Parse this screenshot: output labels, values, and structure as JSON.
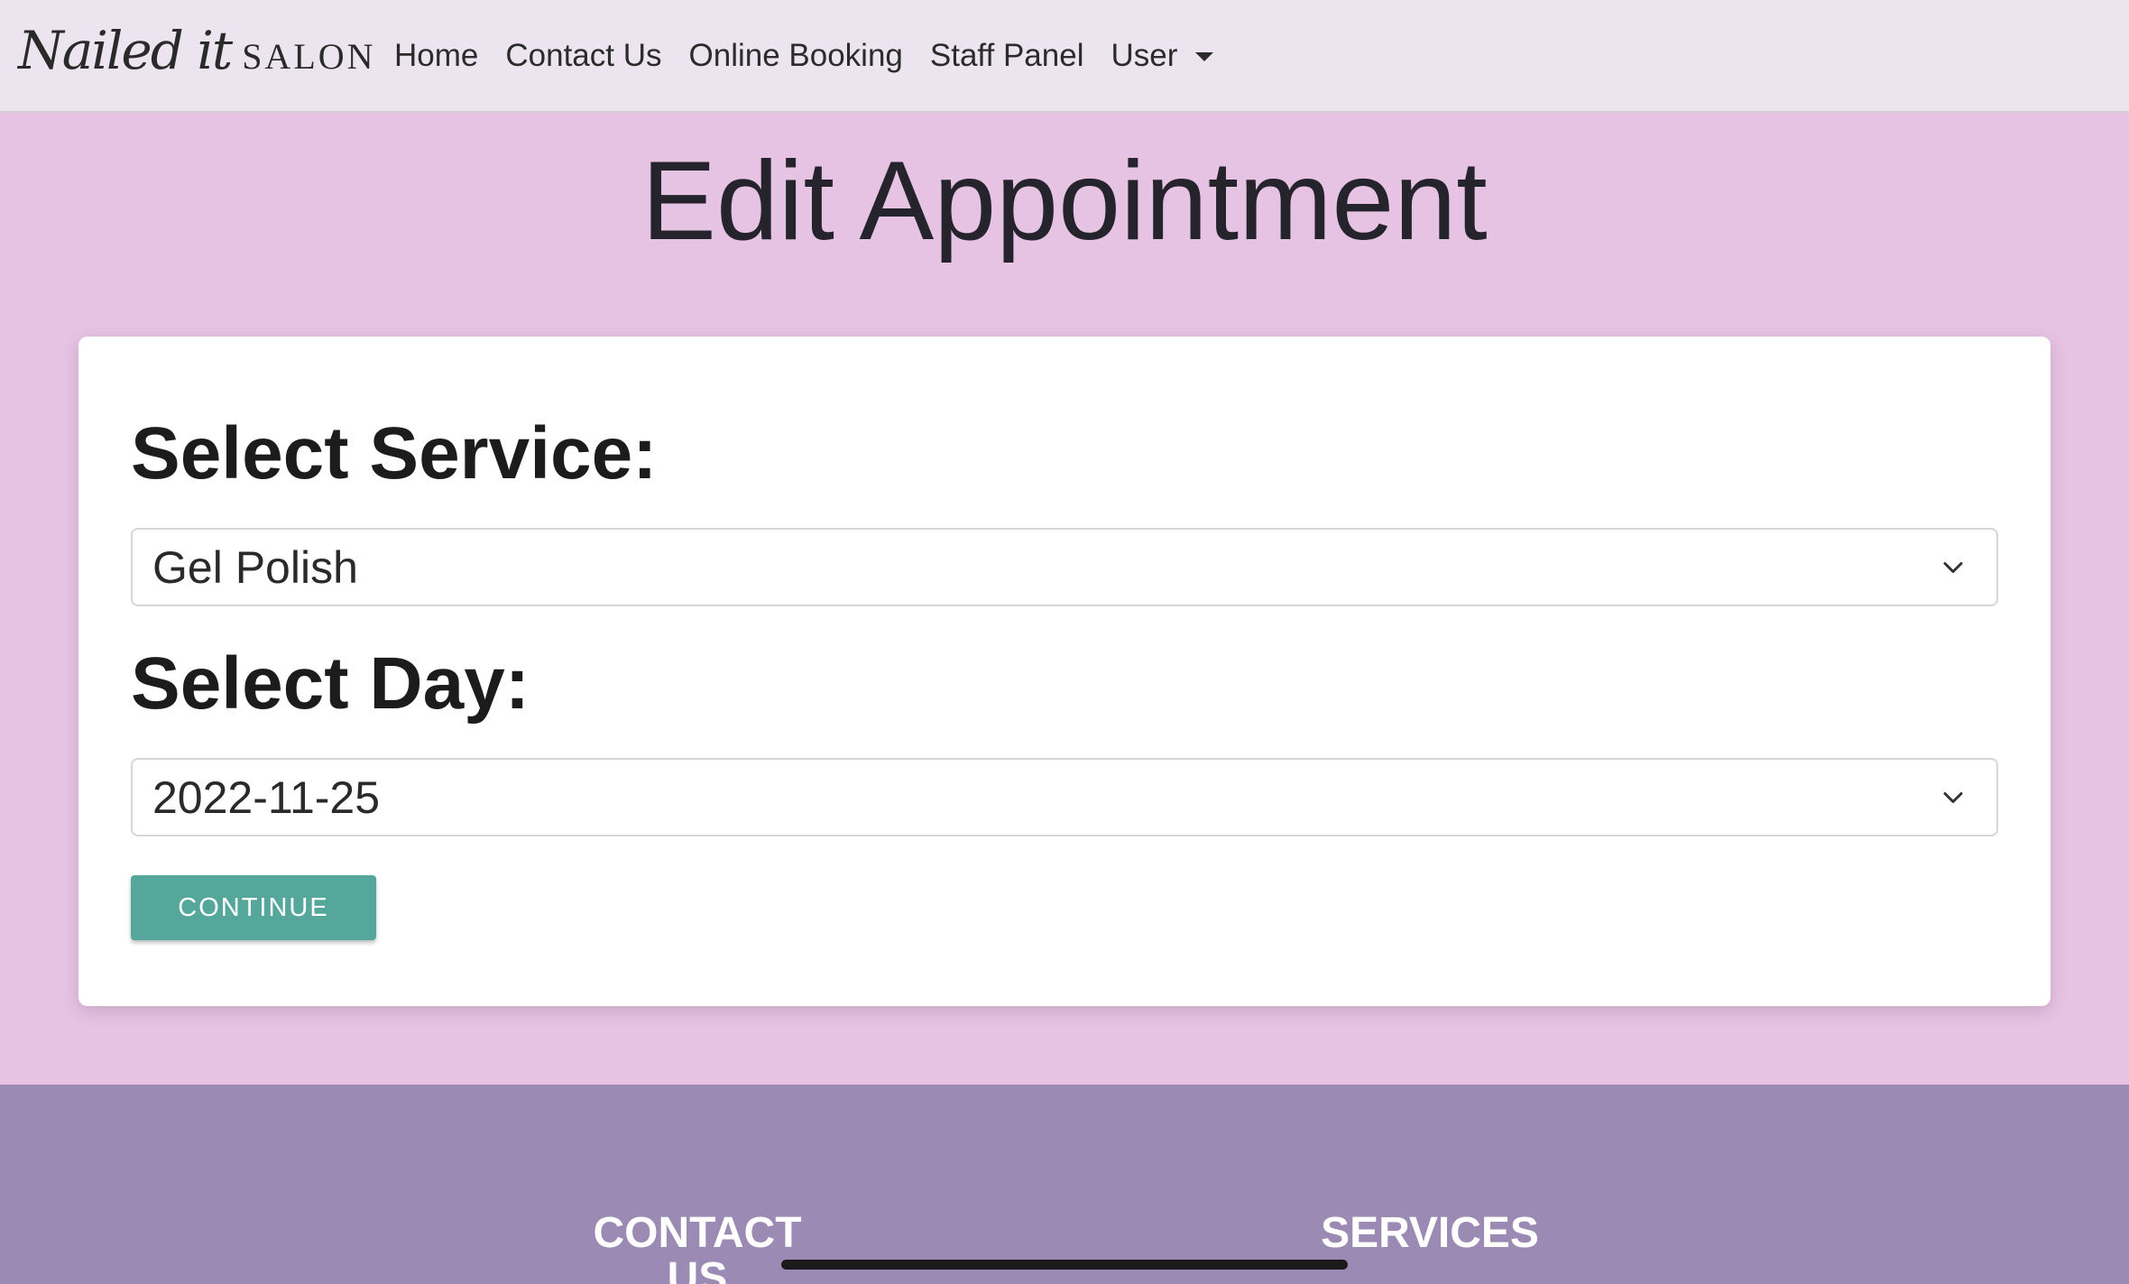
{
  "navbar": {
    "brand_script": "Nailed it",
    "brand_word": "SALON",
    "links": [
      "Home",
      "Contact Us",
      "Online Booking",
      "Staff Panel"
    ],
    "user_menu": "User"
  },
  "page": {
    "title": "Edit Appointment"
  },
  "form": {
    "service_label": "Select Service:",
    "service_value": "Gel Polish",
    "day_label": "Select Day:",
    "day_value": "2022-11-25",
    "continue_label": "CONTINUE"
  },
  "footer": {
    "contact_heading_line1": "CONTACT",
    "contact_heading_line2": "US",
    "services_heading": "SERVICES"
  },
  "colors": {
    "page_background": "#e7c3e3",
    "navbar_background": "#ece4ee",
    "button_accent": "#56a79b",
    "footer_background": "#9a8ab4"
  },
  "icons": [
    "chevron-down-icon",
    "caret-down-icon"
  ]
}
